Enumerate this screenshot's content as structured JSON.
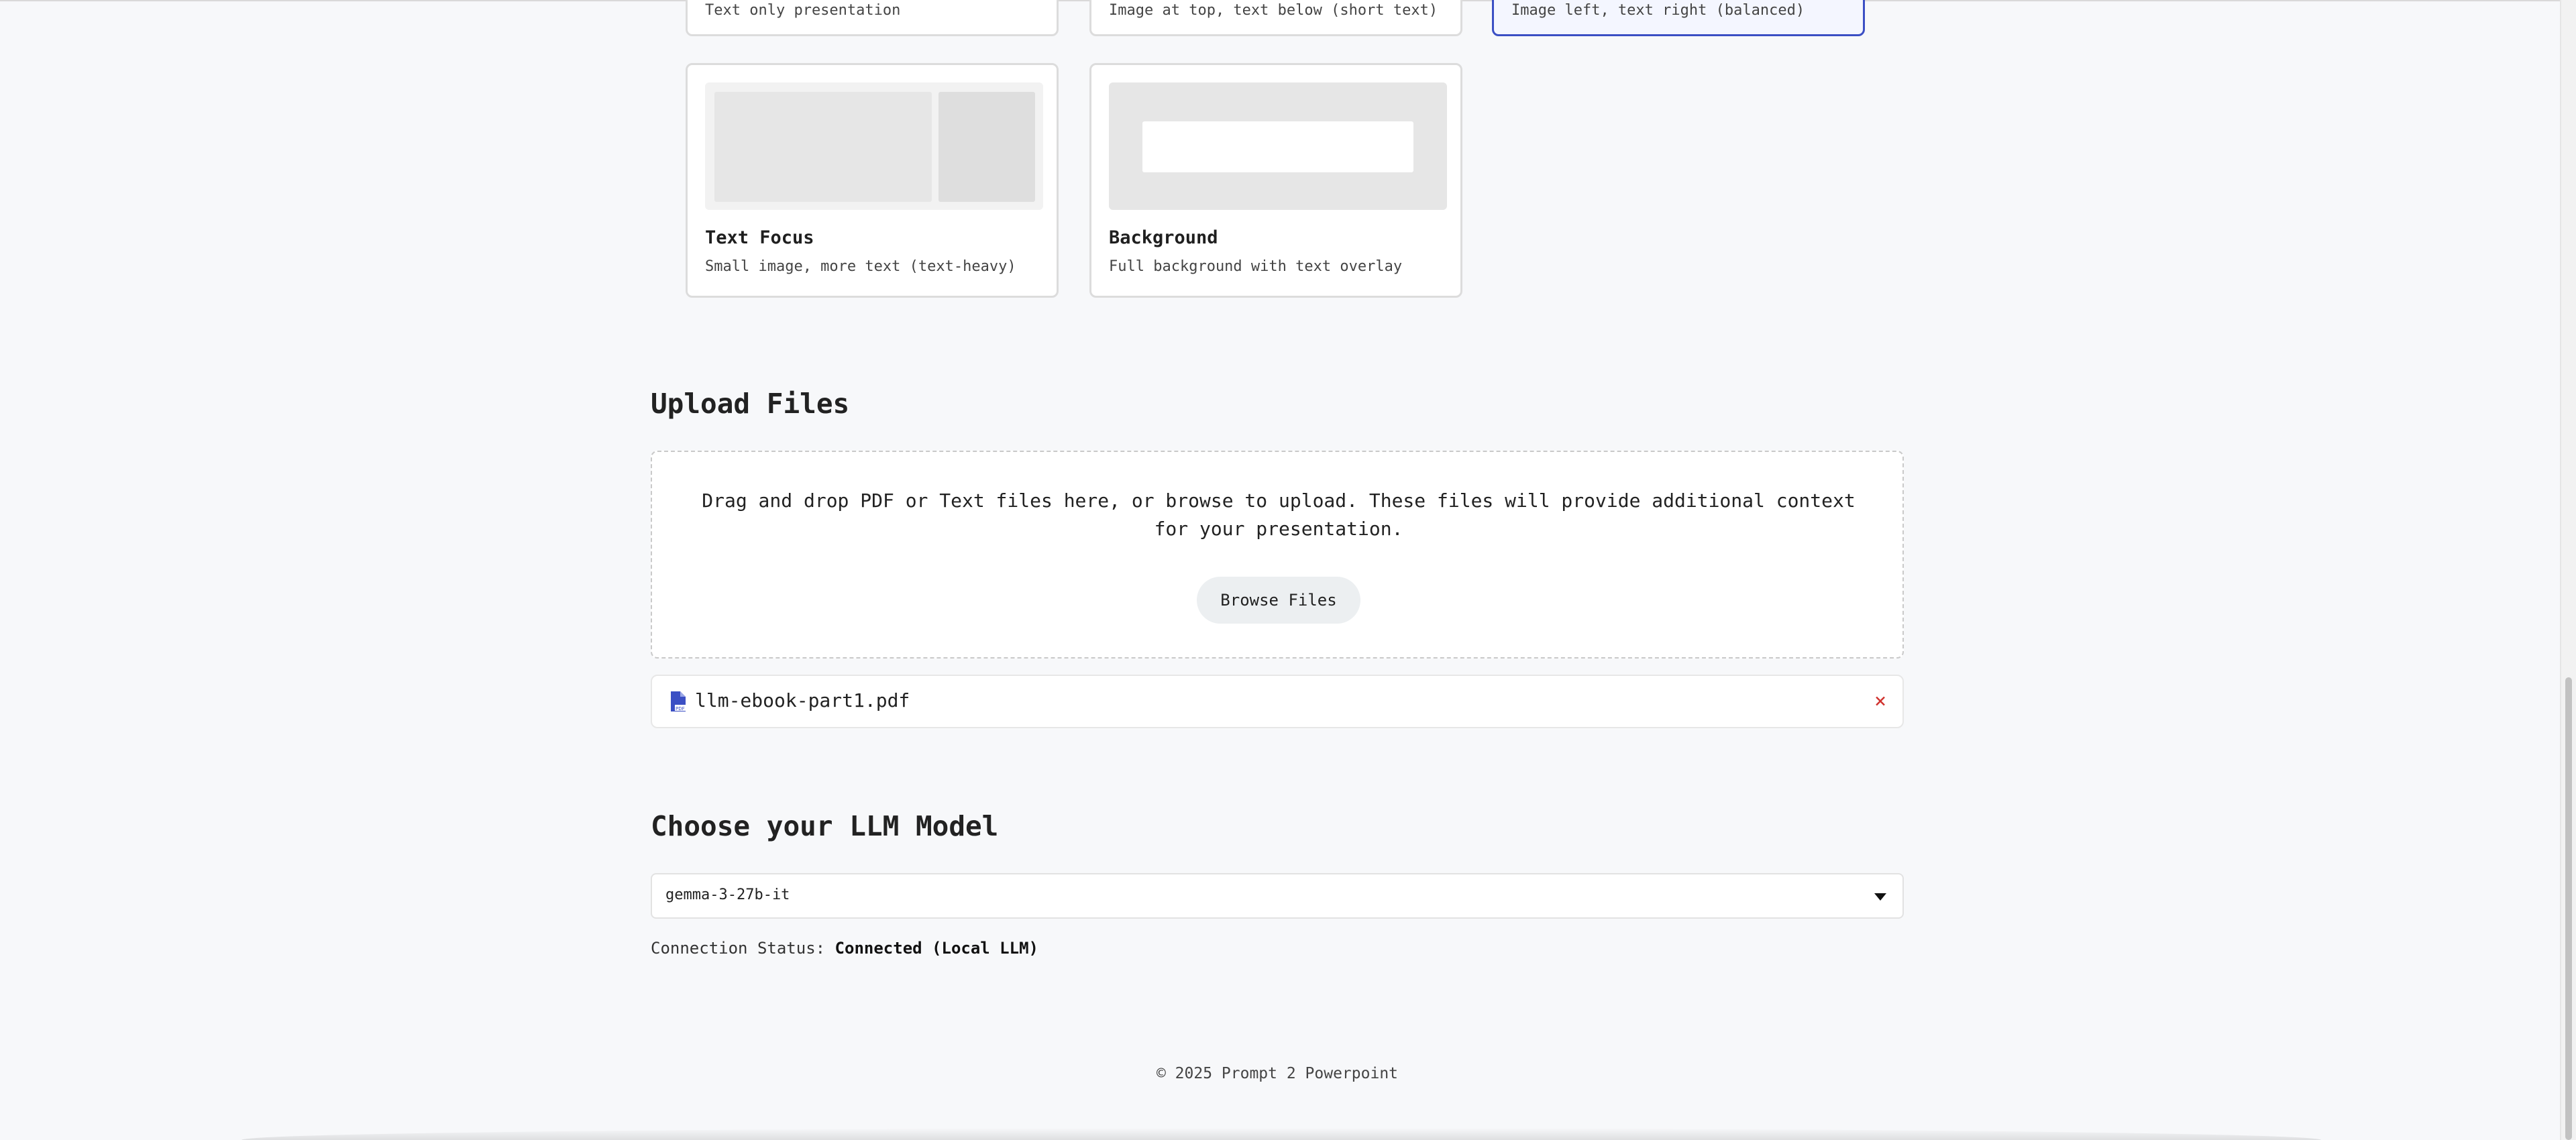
{
  "layout_cards_top": [
    {
      "title": "",
      "desc": "Text only presentation",
      "selected": false
    },
    {
      "title": "",
      "desc": "Image at top, text below (short text)",
      "selected": false
    },
    {
      "title": "",
      "desc": "Image left, text right (balanced)",
      "selected": true
    }
  ],
  "layout_cards_bottom": [
    {
      "title": "Text Focus",
      "desc": "Small image, more text (text-heavy)"
    },
    {
      "title": "Background",
      "desc": "Full background with text overlay"
    }
  ],
  "upload": {
    "title": "Upload Files",
    "instructions": "Drag and drop PDF or Text files here, or browse to upload. These files will provide additional context for your presentation.",
    "browse_label": "Browse Files",
    "files": [
      {
        "name": "llm-ebook-part1.pdf",
        "icon": "pdf-file-icon",
        "remove": "×"
      }
    ]
  },
  "model": {
    "title": "Choose your LLM Model",
    "selected": "gemma-3-27b-it",
    "status_label": "Connection Status:",
    "status_value": "Connected (Local LLM)"
  },
  "footer": {
    "text": "© 2025 Prompt 2 Powerpoint"
  },
  "colors": {
    "accent": "#3b4fc4",
    "remove": "#d0312d",
    "background": "#f7f8fa"
  }
}
